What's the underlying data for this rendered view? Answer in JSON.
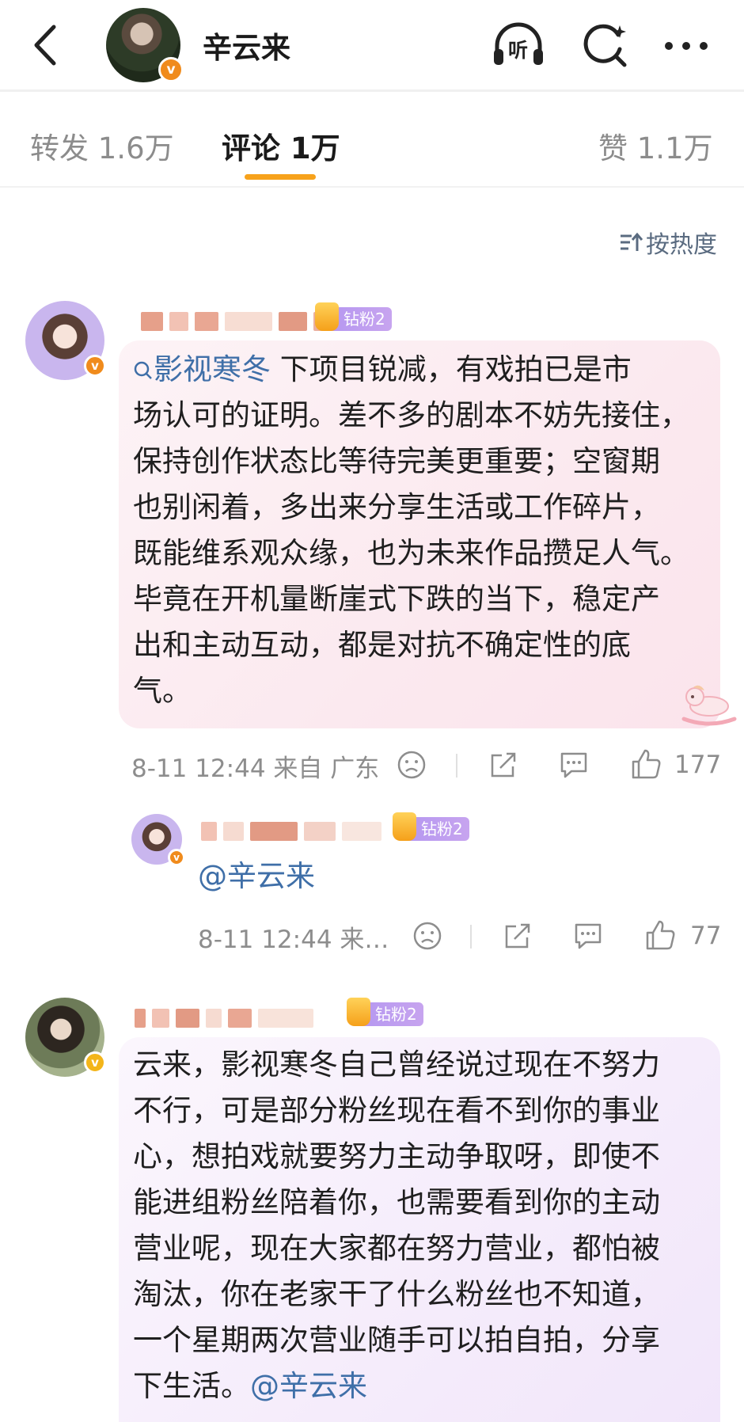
{
  "header": {
    "title": "辛云来",
    "verified_badge": "v",
    "icons": [
      "back-icon",
      "listen-icon",
      "search-icon",
      "more-icon"
    ],
    "listen_label": "听"
  },
  "tabs": [
    {
      "label": "转发 1.6万",
      "active": false
    },
    {
      "label": "评论 1万",
      "active": true
    },
    {
      "label": "赞 1.1万",
      "active": false
    }
  ],
  "sort": {
    "label": "按热度"
  },
  "comments": [
    {
      "fan_badge": "钻粉2",
      "topic": "影视寒冬",
      "text": " 下项目锐减，有戏拍已是市\n场认可的证明。差不多的剧本不妨先接住，\n保持创作状态比等待完美更重要；空窗期\n也别闲着，多出来分享生活或工作碎片，\n既能维系观众缘，也为未来作品攒足人气。\n毕竟在开机量断崖式下跌的当下，稳定产\n出和主动互动，都是对抗不确定性的底\n气。",
      "meta": "8-11 12:44  来自 广东",
      "likes": "177"
    },
    {
      "fan_badge": "钻粉2",
      "mention": "@辛云来",
      "meta": "8-11 12:44  来…",
      "likes": "77"
    },
    {
      "fan_badge": "钻粉2",
      "text": "云来，影视寒冬自己曾经说过现在不努力\n不行，可是部分粉丝现在看不到你的事业\n心，想拍戏就要努力主动争取呀，即使不\n能进组粉丝陪着你，也需要看到你的主动\n营业呢，现在大家都在努力营业，都怕被\n淘汰，你在老家干了什么粉丝也不知道，\n一个星期两次营业随手可以拍自拍，分享\n下生活。",
      "mention": "@辛云来"
    }
  ],
  "colors": {
    "accent": "#f7a21b",
    "link": "#3f6fa8",
    "verified": "#f08b1c",
    "fan_badge": "#b497f0"
  }
}
